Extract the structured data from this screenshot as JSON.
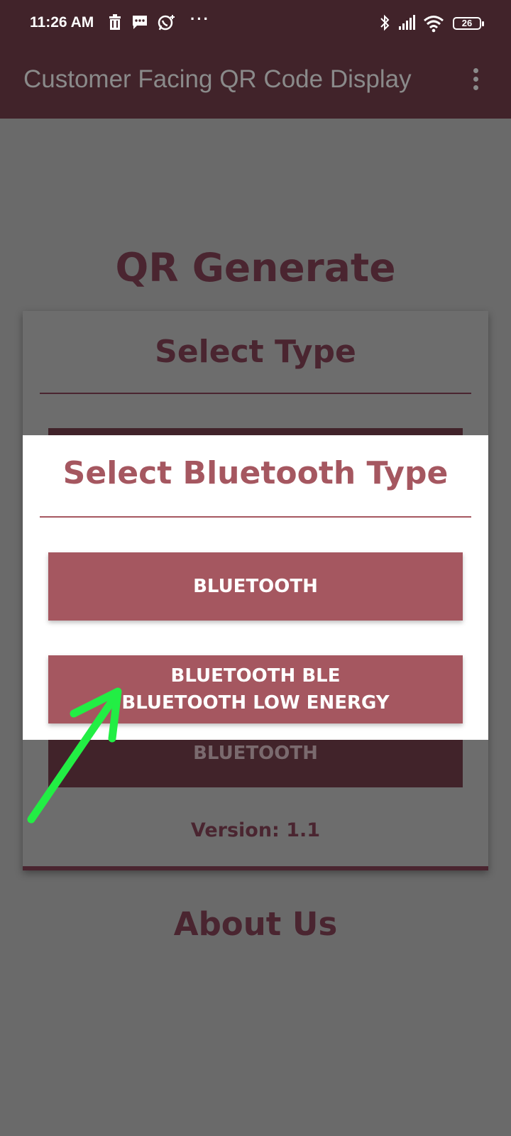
{
  "status_bar": {
    "time": "11:26 AM",
    "battery": "26",
    "icons": [
      "delete-icon",
      "message-icon",
      "whatsapp-icon",
      "more-dots-icon",
      "bluetooth-icon",
      "signal-icon",
      "wifi-icon",
      "battery-icon"
    ]
  },
  "app_bar": {
    "title": "Customer Facing QR Code Display"
  },
  "background": {
    "heading": "QR Generate",
    "card_title": "Select Type",
    "hidden_button_label": "BLUETOOTH",
    "version": "Version: 1.1",
    "about": "About Us"
  },
  "dialog": {
    "title": "Select Bluetooth Type",
    "buttons": [
      {
        "line1": "BLUETOOTH",
        "line2": ""
      },
      {
        "line1": "BLUETOOTH BLE",
        "line2": "BLUETOOTH LOW ENERGY"
      }
    ]
  },
  "colors": {
    "primary_dark": "#41232a",
    "accent": "#a55760",
    "annotation_arrow": "#22ee44"
  }
}
